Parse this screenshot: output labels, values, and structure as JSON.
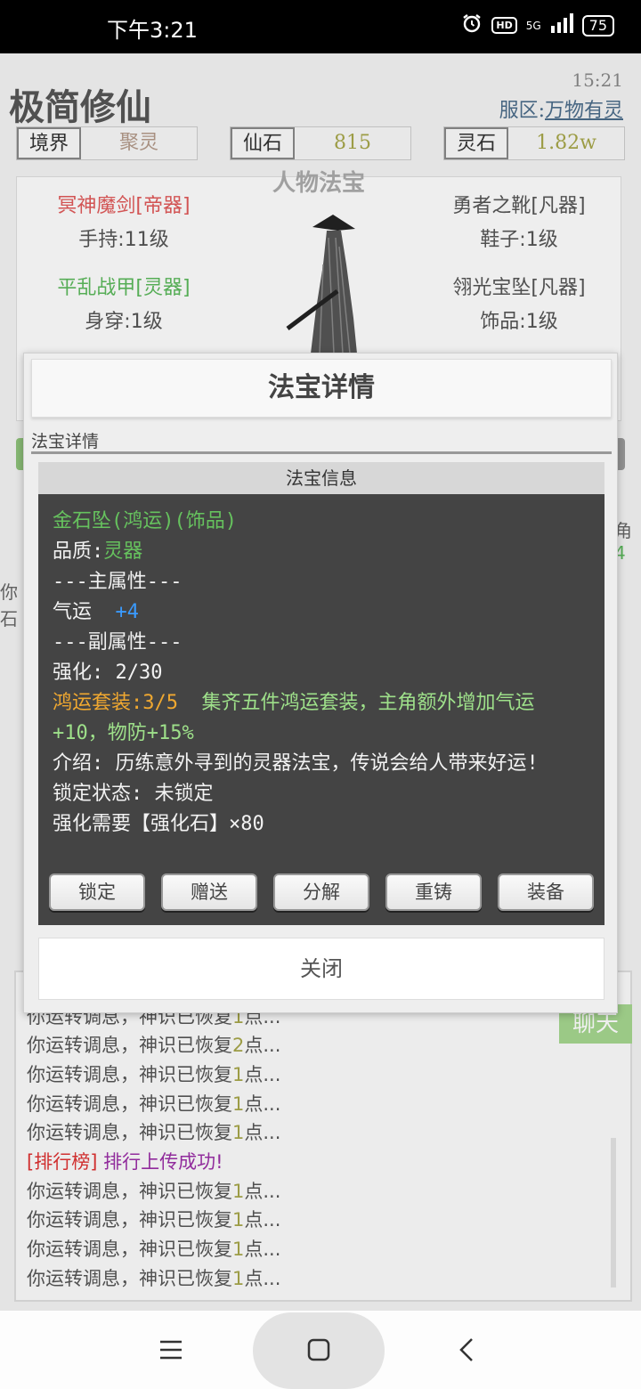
{
  "status_bar": {
    "time": "下午3:21",
    "hd": "HD",
    "network": "5G",
    "battery": "75"
  },
  "app": {
    "title": "极简修仙",
    "clock": "15:21",
    "server_label": "服区:",
    "server_name": "万物有灵",
    "stats": [
      {
        "label": "境界",
        "value": "聚灵",
        "value_color": "#b39a8a"
      },
      {
        "label": "仙石",
        "value": "815",
        "value_color": "#a6a64a"
      },
      {
        "label": "灵石",
        "value": "1.82w",
        "value_color": "#a6a64a"
      }
    ],
    "equip_title": "人物法宝",
    "equipment": [
      {
        "name": "冥神魔剑[帝器]",
        "slot": "手持:11级",
        "color": "#e05a5a"
      },
      {
        "name": "平乱战甲[灵器]",
        "slot": "身穿:1级",
        "color": "#5cb85c"
      },
      {
        "name": "勇者之靴[凡器]",
        "slot": "鞋子:1级",
        "color": "#555555"
      },
      {
        "name": "翎光宝坠[凡器]",
        "slot": "饰品:1级",
        "color": "#555555"
      }
    ],
    "side_right": [
      "角",
      "4"
    ],
    "side_left": [
      "你",
      "石"
    ]
  },
  "log": {
    "lines": [
      {
        "pre": "你运转调息，神识已恢复",
        "num": "1",
        "post": "点..."
      },
      {
        "pre": "你运转调息，神识已恢复",
        "num": "2",
        "post": "点..."
      },
      {
        "pre": "你运转调息，神识已恢复",
        "num": "1",
        "post": "点..."
      },
      {
        "pre": "你运转调息，神识已恢复",
        "num": "1",
        "post": "点..."
      },
      {
        "pre": "你运转调息，神识已恢复",
        "num": "1",
        "post": "点..."
      },
      {
        "rank_tag": "[排行榜]",
        "rank_msg": " 排行上传成功!"
      },
      {
        "pre": "你运转调息，神识已恢复",
        "num": "1",
        "post": "点..."
      },
      {
        "pre": "你运转调息，神识已恢复",
        "num": "1",
        "post": "点..."
      },
      {
        "pre": "你运转调息，神识已恢复",
        "num": "1",
        "post": "点..."
      },
      {
        "pre": "你运转调息，神识已恢复",
        "num": "1",
        "post": "点..."
      }
    ],
    "chat_button": "聊天"
  },
  "modal": {
    "title": "法宝详情",
    "subtitle": "法宝详情",
    "info_header": "法宝信息",
    "item_name": "金石坠(鸿运)(饰品)",
    "quality_label": "品质:",
    "quality_value": "灵器",
    "main_attr_header": "---主属性---",
    "main_attr_name": "气运",
    "main_attr_value": "+4",
    "sub_attr_header": "---副属性---",
    "enhance": "强化: 2/30",
    "set_name": "鸿运套装:3/5",
    "set_desc_1": "集齐五件鸿运套装，主角额外增加气运",
    "set_desc_2": "+10，物防+15%",
    "intro": "介绍: 历练意外寻到的灵器法宝，传说会给人带来好运!",
    "lock_state": "锁定状态: 未锁定",
    "enhance_need": "强化需要【强化石】×80",
    "buttons": [
      "锁定",
      "赠送",
      "分解",
      "重铸",
      "装备"
    ],
    "close": "关闭"
  }
}
